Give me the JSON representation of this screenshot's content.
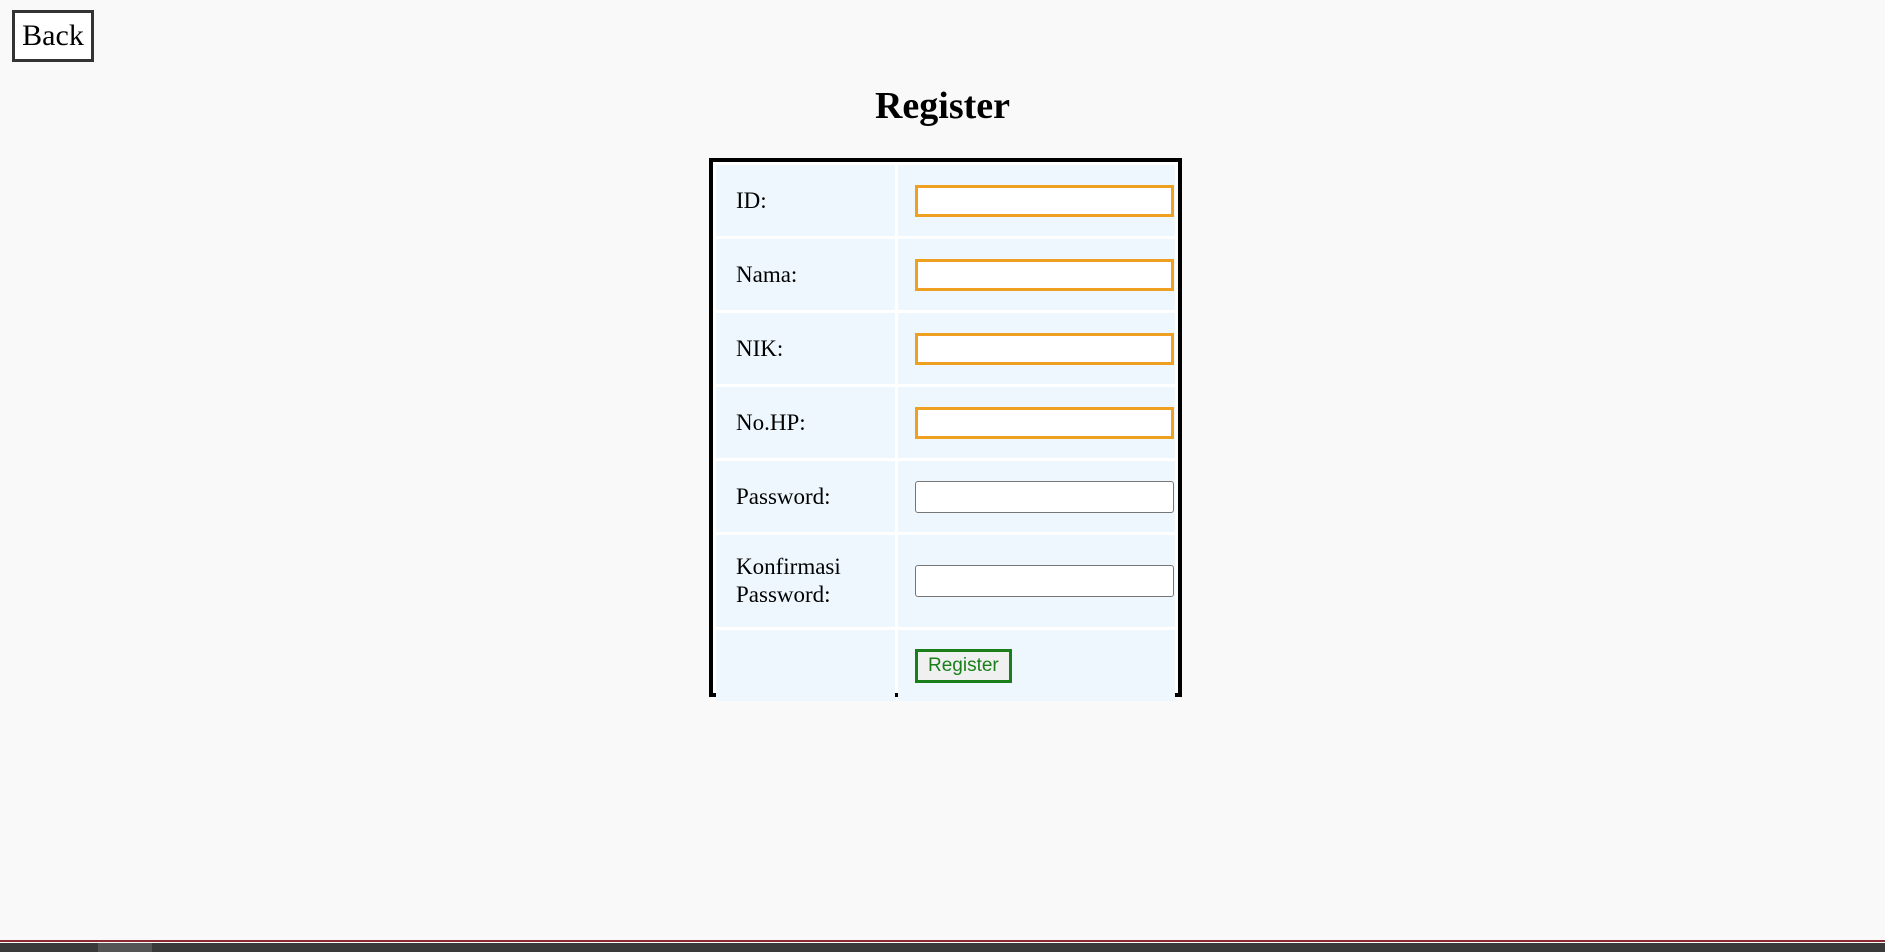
{
  "nav": {
    "back_label": "Back"
  },
  "page": {
    "title": "Register"
  },
  "form": {
    "fields": [
      {
        "label": "ID:",
        "value": "",
        "style": "highlight"
      },
      {
        "label": "Nama:",
        "value": "",
        "style": "highlight"
      },
      {
        "label": "NIK:",
        "value": "",
        "style": "highlight"
      },
      {
        "label": "No.HP:",
        "value": "",
        "style": "highlight"
      },
      {
        "label": "Password:",
        "value": "",
        "style": "plain"
      },
      {
        "label_line1": "Konfirmasi",
        "label_line2": "Password:",
        "value": "",
        "style": "plain"
      }
    ],
    "submit_label": "Register"
  },
  "colors": {
    "background": "#f9f9f9",
    "cell_background": "#eef7fe",
    "required_border": "#f0a020",
    "submit_accent": "#1a7f1a",
    "footer_line": "#8b2a30"
  }
}
